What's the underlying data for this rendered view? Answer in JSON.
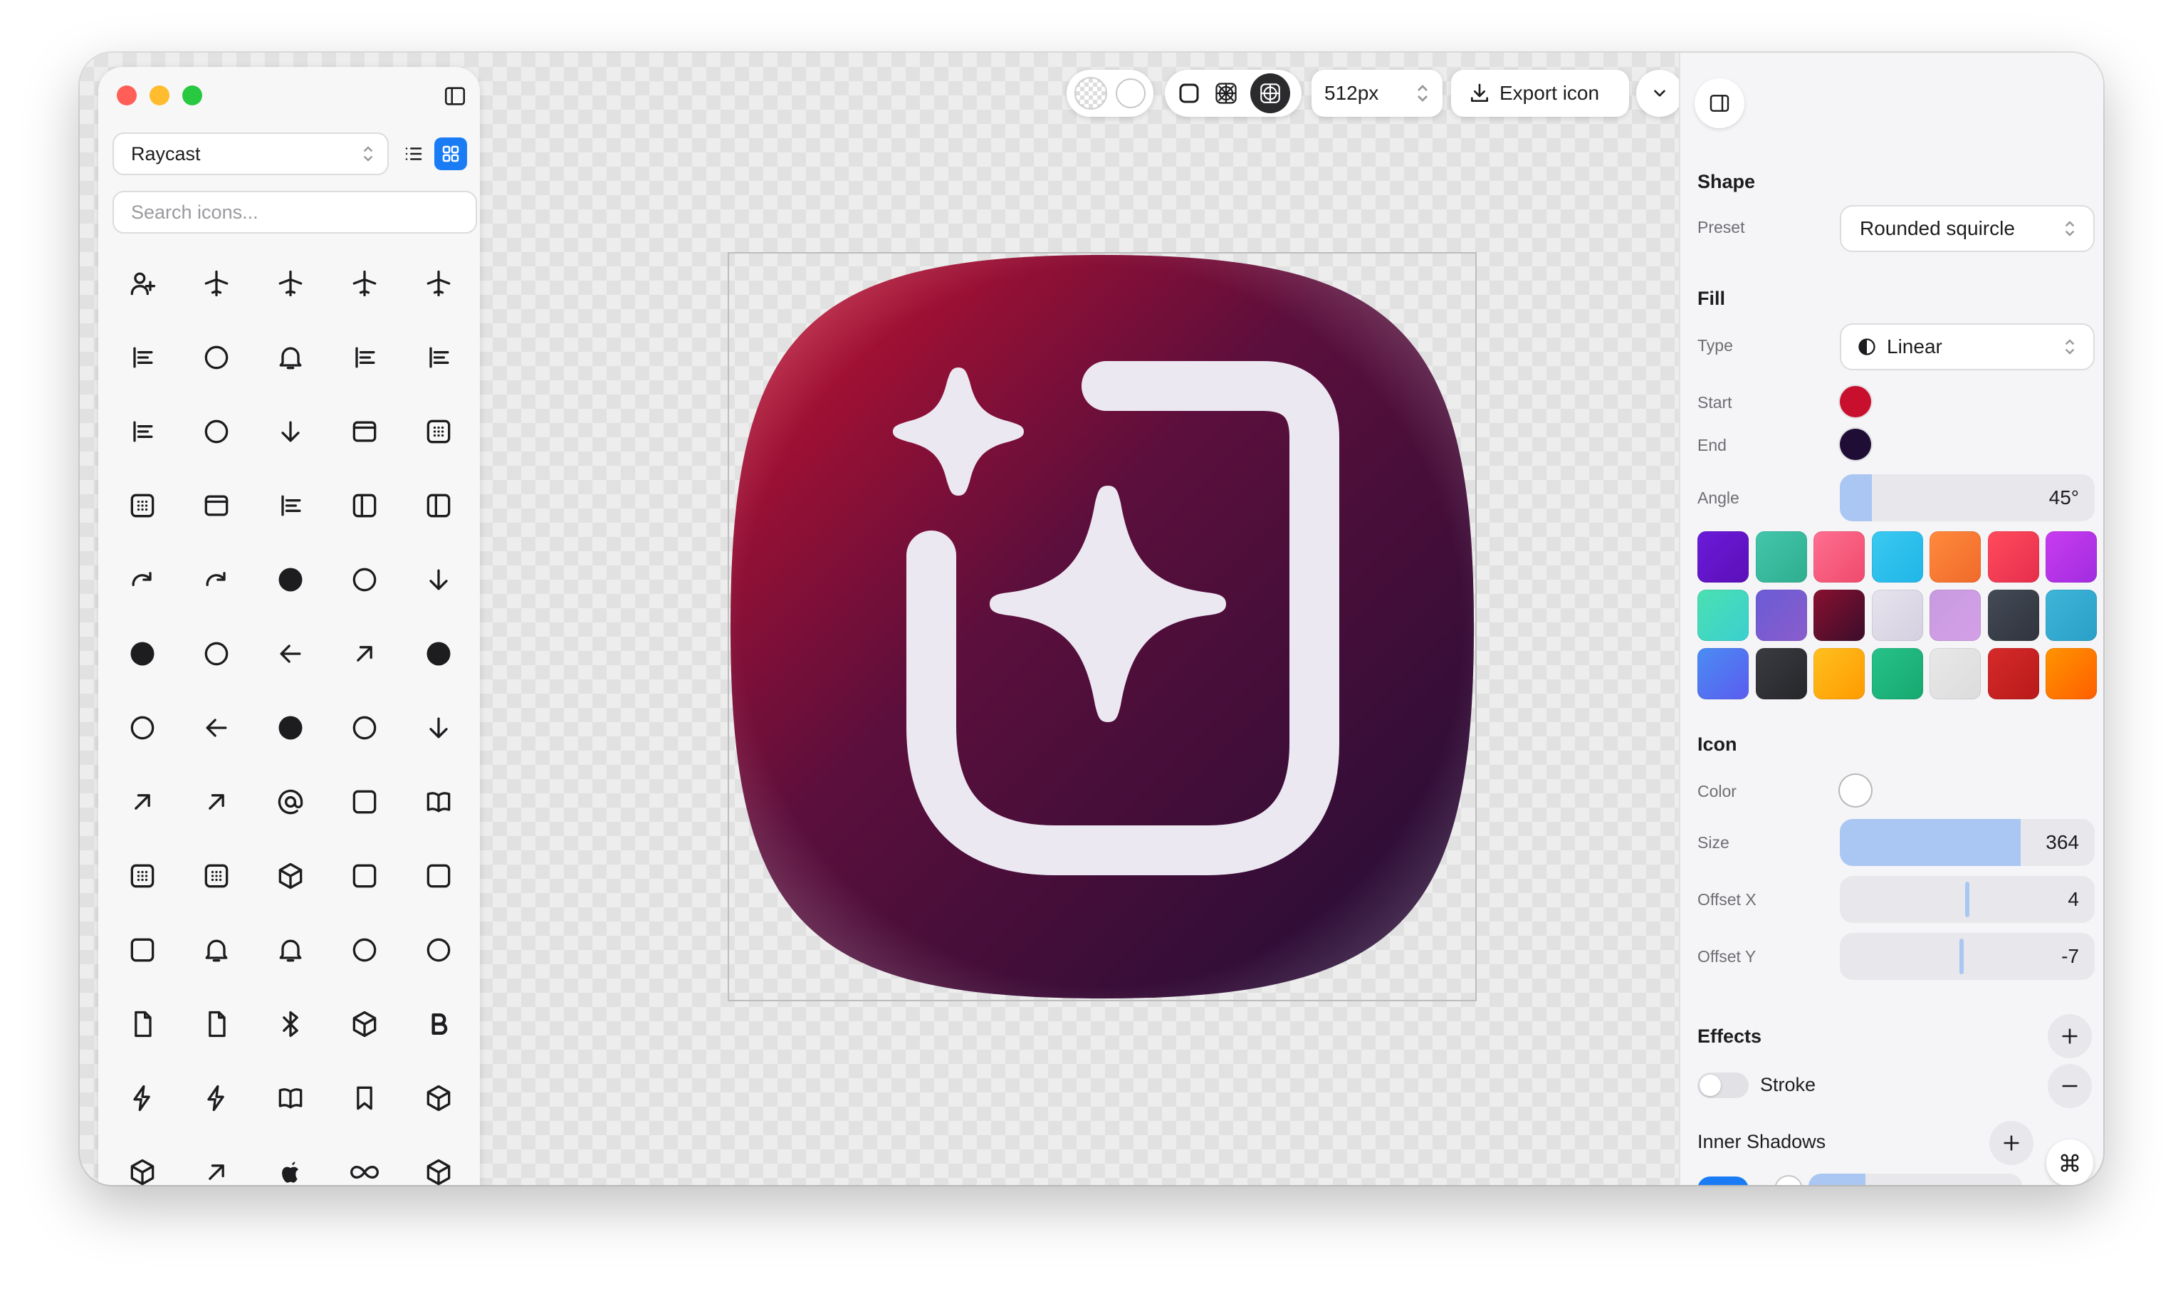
{
  "sidebar": {
    "source_select": "Raycast",
    "search_placeholder": "Search icons...",
    "icons": [
      "person-add-icon",
      "airplane-icon",
      "airplane-outline-icon",
      "airplane-landing-icon",
      "airplane-takeoff-icon",
      "airpods-icon",
      "alarm-icon",
      "alarm-ringing-icon",
      "align-center-icon",
      "align-left-icon",
      "align-right-icon",
      "american-football-icon",
      "anchor-icon",
      "app-window-icon",
      "app-window-grid-icon",
      "app-window-grid-3-icon",
      "app-window-sidebar-icon",
      "app-window-list-icon",
      "app-window-sidebar-left-icon",
      "app-window-sidebar-right-icon",
      "arrow-clockwise-icon",
      "arrow-counter-clockwise-icon",
      "arrow-down-circle-filled-icon",
      "arrow-down-circle-icon",
      "arrow-down-icon",
      "arrow-left-circle-filled-icon",
      "arrow-left-circle-icon",
      "arrow-left-icon",
      "arrow-ne-icon",
      "arrow-right-circle-filled-icon",
      "arrow-right-circle-icon",
      "arrow-right-icon",
      "arrow-up-circle-filled-icon",
      "arrow-up-circle-icon",
      "arrow-up-icon",
      "arrows-contract-icon",
      "arrows-expand-icon",
      "at-symbol-icon",
      "bandage-icon",
      "banknote-icon",
      "bar-chart-icon",
      "barcode-icon",
      "bath-icon",
      "battery-charging-icon",
      "battery-disabled-icon",
      "battery-icon",
      "bell-disabled-icon",
      "bell-icon",
      "bike-icon",
      "binoculars-icon",
      "blank-document-icon",
      "blank-document-icon",
      "bluetooth-icon",
      "boat-icon",
      "bold-icon",
      "bolt-disabled-icon",
      "bolt-icon",
      "book-icon",
      "bookmark-icon",
      "box-icon",
      "brand-a-icon",
      "brand-adobe-icon",
      "brand-apple-icon",
      "brand-infinity-icon",
      "brand-cubes-icon"
    ]
  },
  "toolbar": {
    "size_value": "512px",
    "export_label": "Export icon"
  },
  "canvas": {
    "icon_name": "sparkle-image-icon",
    "gradient_start": "#c8102e",
    "gradient_end": "#200d35",
    "glyph_color": "#ece8f2"
  },
  "panel": {
    "shape": {
      "title": "Shape",
      "preset_label": "Preset",
      "preset_value": "Rounded squircle"
    },
    "fill": {
      "title": "Fill",
      "type_label": "Type",
      "type_value": "Linear",
      "start_label": "Start",
      "start_color": "#c8102e",
      "end_label": "End",
      "end_color": "#200d35",
      "angle_label": "Angle",
      "angle_value": "45°",
      "angle_fraction": 0.125,
      "presets": [
        [
          "#6a1bd9",
          "#5c0fb8"
        ],
        [
          "#43c6ac",
          "#2fae8f"
        ],
        [
          "#ff6f91",
          "#ef4a6c"
        ],
        [
          "#3bc9f0",
          "#1fb6e8"
        ],
        [
          "#ff8a3d",
          "#f06a2a"
        ],
        [
          "#ff4b5c",
          "#e62e4d"
        ],
        [
          "#c93cf0",
          "#a12ce0"
        ],
        [
          "#4be0b0",
          "#3ad0d0"
        ],
        [
          "#6a5cd6",
          "#8a5ccc"
        ],
        [
          "#8a1030",
          "#3a0d2a"
        ],
        [
          "#e6e3ee",
          "#d4d0e0"
        ],
        [
          "#c89adf",
          "#d4a0e8"
        ],
        [
          "#444b57",
          "#2f343d"
        ],
        [
          "#3fb5d8",
          "#2a9fc8"
        ],
        [
          "#4a8df2",
          "#5b5cf0"
        ],
        [
          "#3a3b40",
          "#26272b"
        ],
        [
          "#ffc020",
          "#ff9a00"
        ],
        [
          "#27c28a",
          "#16a86e"
        ],
        [
          "#e8e8e8",
          "#dcdcdc"
        ],
        [
          "#d62a2a",
          "#b81a1a"
        ],
        [
          "#ff9500",
          "#ff5e00"
        ]
      ]
    },
    "icon": {
      "title": "Icon",
      "color_label": "Color",
      "color_value": "#ffffff",
      "size_label": "Size",
      "size_value": "364",
      "size_fraction": 0.71,
      "offset_x_label": "Offset X",
      "offset_x_value": "4",
      "offset_y_label": "Offset Y",
      "offset_y_value": "-7"
    },
    "effects": {
      "title": "Effects",
      "stroke_label": "Stroke",
      "inner_shadows_label": "Inner Shadows"
    }
  }
}
